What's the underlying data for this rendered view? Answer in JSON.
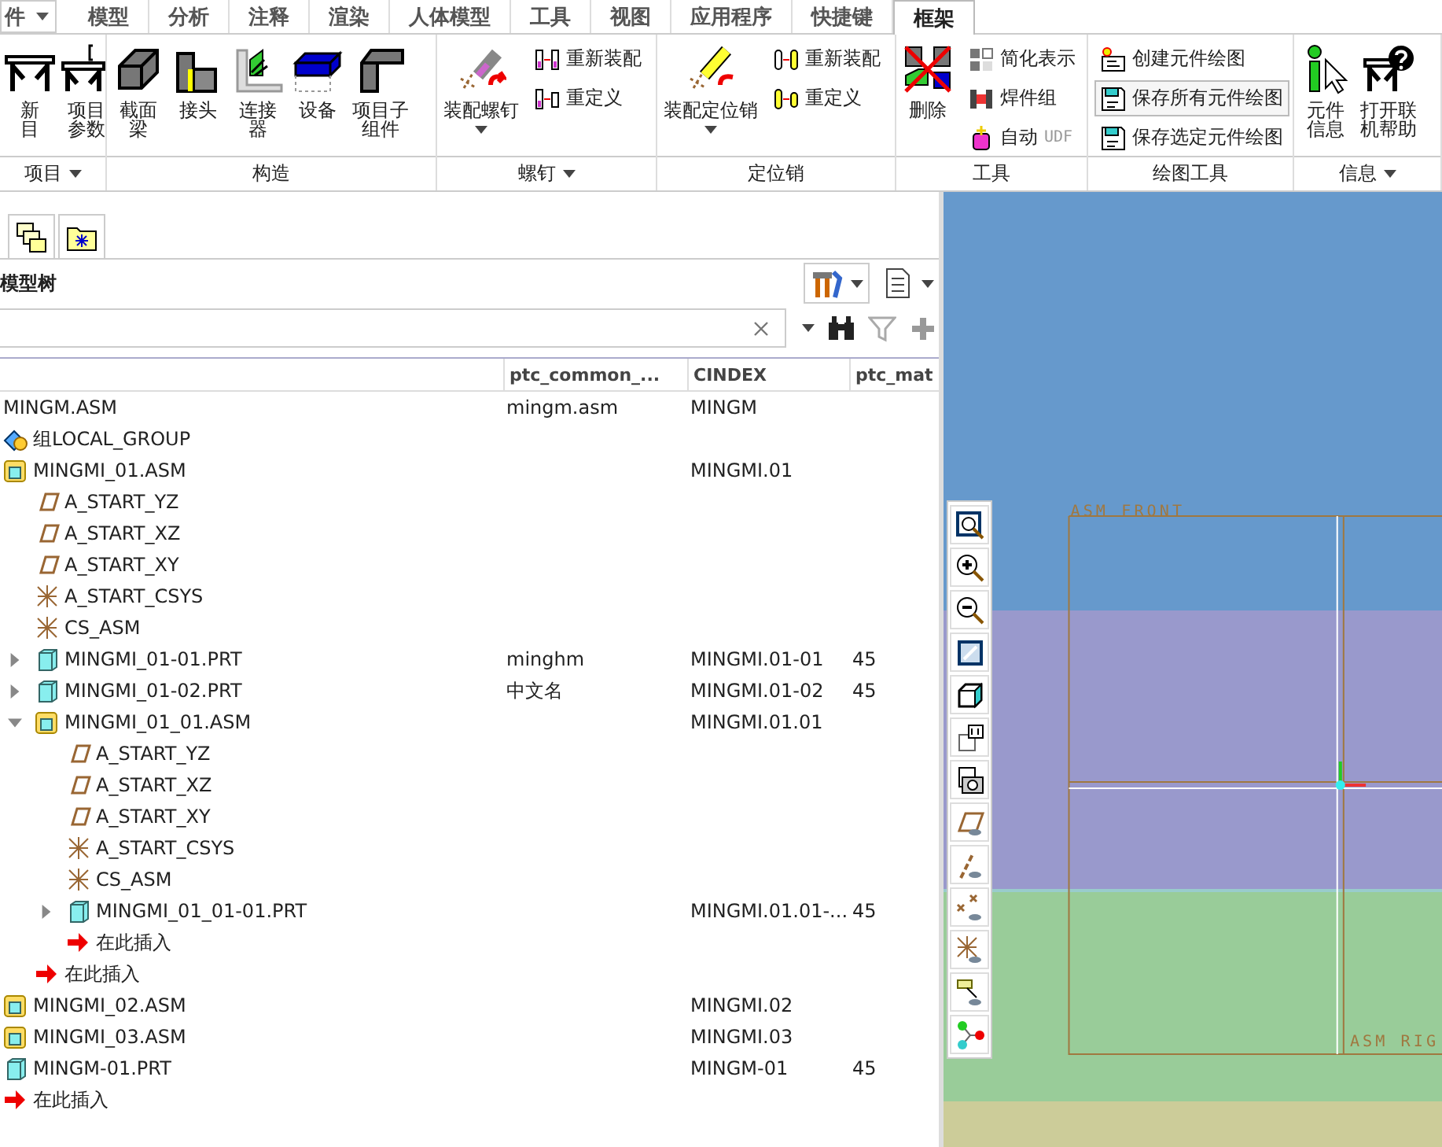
{
  "tabs": [
    {
      "label": "件",
      "dropdown": true,
      "selected": false
    },
    {
      "label": "模型",
      "selected": false
    },
    {
      "label": "分析",
      "selected": false
    },
    {
      "label": "注释",
      "selected": false
    },
    {
      "label": "渲染",
      "selected": false
    },
    {
      "label": "人体模型",
      "selected": false
    },
    {
      "label": "工具",
      "selected": false
    },
    {
      "label": "视图",
      "selected": false
    },
    {
      "label": "应用程序",
      "selected": false
    },
    {
      "label": "快捷键",
      "selected": false
    },
    {
      "label": "框架",
      "selected": true
    }
  ],
  "ribbon_groups": [
    {
      "label": "项目",
      "dropdown": true,
      "big": [
        {
          "lines": [
            "新",
            "目"
          ]
        },
        {
          "lines": [
            "项目",
            "参数"
          ]
        }
      ]
    },
    {
      "label": "构造",
      "dropdown": false,
      "big": [
        {
          "lines": [
            "截面",
            "梁"
          ]
        },
        {
          "lines": [
            "接头"
          ]
        },
        {
          "lines": [
            "连接",
            "器"
          ]
        },
        {
          "lines": [
            "设备"
          ]
        },
        {
          "lines": [
            "项目子",
            "组件"
          ]
        }
      ]
    },
    {
      "label": "螺钉",
      "dropdown": true,
      "big": [
        {
          "lines": [
            "装配螺钉"
          ],
          "dropdown": true
        }
      ],
      "small": [
        {
          "label": "重新装配",
          "hovered": false
        },
        {
          "label": "重定义",
          "hovered": false
        }
      ]
    },
    {
      "label": "定位销",
      "dropdown": false,
      "big": [
        {
          "lines": [
            "装配定位销"
          ],
          "dropdown": true
        }
      ],
      "small": [
        {
          "label": "重新装配",
          "hovered": false
        },
        {
          "label": "重定义",
          "hovered": false
        }
      ]
    },
    {
      "label": "工具",
      "dropdown": false,
      "big": [
        {
          "lines": [
            "删除"
          ]
        }
      ],
      "small": [
        {
          "label": "简化表示",
          "hovered": false
        },
        {
          "label": "焊件组",
          "hovered": false
        },
        {
          "label": "自动",
          "suffix": "UDF",
          "hovered": false
        }
      ]
    },
    {
      "label": "绘图工具",
      "dropdown": false,
      "small": [
        {
          "label": "创建元件绘图",
          "hovered": false
        },
        {
          "label": "保存所有元件绘图",
          "hovered": true
        },
        {
          "label": "保存选定元件绘图",
          "hovered": false
        }
      ]
    },
    {
      "label": "信息",
      "dropdown": true,
      "big": [
        {
          "lines": [
            "元件",
            "信息"
          ]
        },
        {
          "lines": [
            "打开联",
            "机帮助"
          ]
        }
      ]
    }
  ],
  "model_tree": {
    "title": "模型树",
    "columns": [
      "ptc_common_...",
      "CINDEX",
      "ptc_mat"
    ],
    "rows": [
      {
        "name": "MINGM.ASM",
        "kind": "root",
        "ptc_common": "mingm.asm",
        "cindex": "MINGM"
      },
      {
        "name": "组LOCAL_GROUP",
        "kind": "group"
      },
      {
        "name": "MINGMI_01.ASM",
        "kind": "assembly",
        "cindex": "MINGMI.01",
        "children": [
          {
            "name": "A_START_YZ",
            "kind": "plane"
          },
          {
            "name": "A_START_XZ",
            "kind": "plane"
          },
          {
            "name": "A_START_XY",
            "kind": "plane"
          },
          {
            "name": "A_START_CSYS",
            "kind": "csys"
          },
          {
            "name": "CS_ASM",
            "kind": "csys"
          },
          {
            "name": "MINGMI_01-01.PRT",
            "kind": "part",
            "expanded": false,
            "ptc_common": "minghm",
            "cindex": "MINGMI.01-01",
            "ptc_mat": "45"
          },
          {
            "name": "MINGMI_01-02.PRT",
            "kind": "part",
            "expanded": false,
            "ptc_common": "中文名",
            "cindex": "MINGMI.01-02",
            "ptc_mat": "45"
          },
          {
            "name": "MINGMI_01_01.ASM",
            "kind": "assembly",
            "expanded": true,
            "cindex": "MINGMI.01.01",
            "children": [
              {
                "name": "A_START_YZ",
                "kind": "plane"
              },
              {
                "name": "A_START_XZ",
                "kind": "plane"
              },
              {
                "name": "A_START_XY",
                "kind": "plane"
              },
              {
                "name": "A_START_CSYS",
                "kind": "csys"
              },
              {
                "name": "CS_ASM",
                "kind": "csys"
              },
              {
                "name": "MINGMI_01_01-01.PRT",
                "kind": "part",
                "expanded": false,
                "cindex": "MINGMI.01.01-...",
                "ptc_mat": "45"
              },
              {
                "name": "在此插入",
                "kind": "insert"
              }
            ]
          },
          {
            "name": "在此插入",
            "kind": "insert"
          }
        ]
      },
      {
        "name": "MINGMI_02.ASM",
        "kind": "assembly",
        "cindex": "MINGMI.02"
      },
      {
        "name": "MINGMI_03.ASM",
        "kind": "assembly",
        "cindex": "MINGMI.03"
      },
      {
        "name": "MINGM-01.PRT",
        "kind": "part",
        "cindex": "MINGM-01",
        "ptc_mat": "45"
      },
      {
        "name": "在此插入",
        "kind": "insert"
      }
    ]
  },
  "graphics": {
    "datum_labels": [
      "ASM FRONT",
      "ASM RIG"
    ]
  }
}
